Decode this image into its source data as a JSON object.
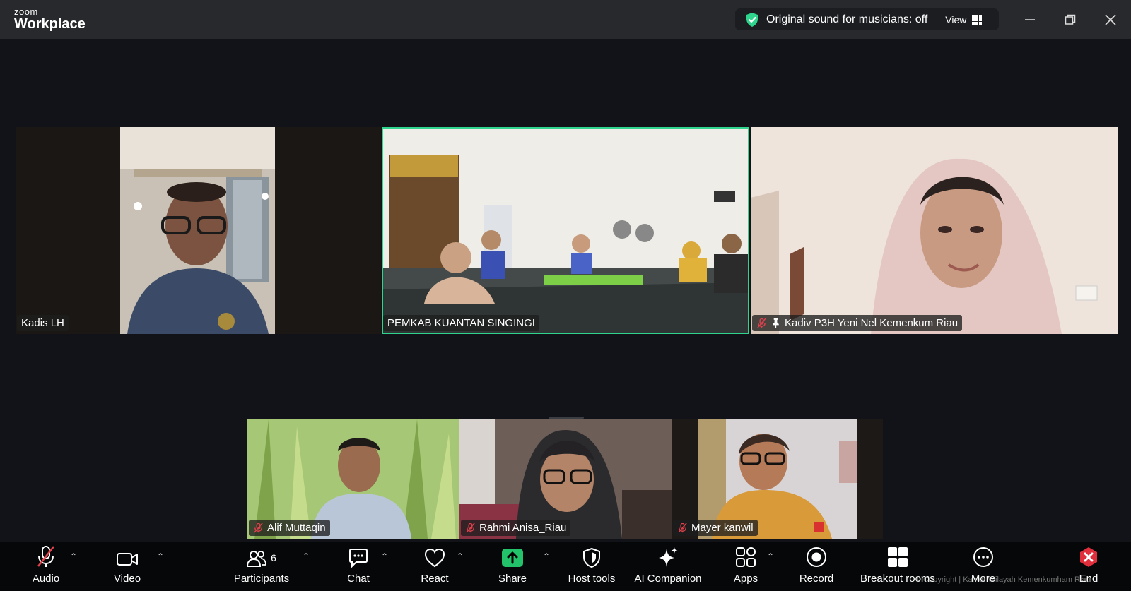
{
  "app": {
    "logo_top": "zoom",
    "logo_bottom": "Workplace"
  },
  "header": {
    "sound_status": "Original sound for musicians: off",
    "view_label": "View"
  },
  "window_controls": [
    "minimize-icon",
    "restore-icon",
    "close-icon"
  ],
  "participants_top": [
    {
      "name": "Kadis LH",
      "muted": false
    },
    {
      "name": "PEMKAB KUANTAN SINGINGI",
      "muted": false,
      "active_speaker": true
    },
    {
      "name": "Kadiv P3H Yeni Nel Kemenkum Riau",
      "muted": true,
      "pinned": true
    }
  ],
  "participants_bottom": [
    {
      "name": "Alif Muttaqin",
      "muted": true
    },
    {
      "name": "Rahmi Anisa_Riau",
      "muted": true
    },
    {
      "name": "Mayer kanwil",
      "muted": true
    }
  ],
  "toolbar": {
    "audio": "Audio",
    "video": "Video",
    "participants": "Participants",
    "participants_count": "6",
    "chat": "Chat",
    "react": "React",
    "share": "Share",
    "host_tools": "Host tools",
    "ai_companion": "AI Companion",
    "apps": "Apps",
    "record": "Record",
    "breakout_rooms": "Breakout rooms",
    "more": "More",
    "end": "End"
  },
  "watermark": "© Copyright | Kantor Wilayah Kemenkumham Riau",
  "colors": {
    "accent_green": "#2fd58c",
    "end_red": "#e02e3d",
    "share_green": "#23c36b",
    "muted_red": "#e0414d"
  }
}
